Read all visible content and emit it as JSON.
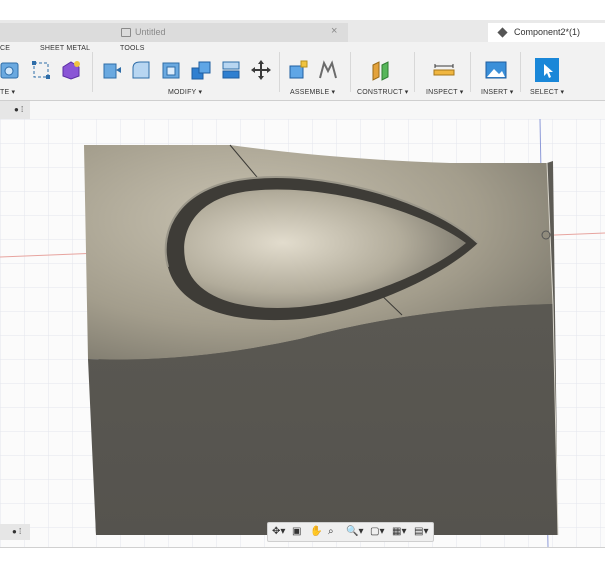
{
  "tabs": {
    "document_title": "Untitled",
    "component_title": "Component2*(1)",
    "close_glyph": "×"
  },
  "toolbar": {
    "menus": {
      "create_partial": "CE",
      "sheet_metal": "SHEET METAL",
      "tools": "TOOLS"
    },
    "groups": {
      "create_partial": "TE ▾",
      "modify": "MODIFY ▾",
      "assemble": "ASSEMBLE ▾",
      "construct": "CONSTRUCT ▾",
      "inspect": "INSPECT ▾",
      "insert": "INSERT ▾",
      "select": "SELECT ▾"
    },
    "icons": [
      "box-icon",
      "sketch-icon",
      "form-icon",
      "press-pull-icon",
      "fillet-icon",
      "shell-icon",
      "combine-icon",
      "replace-face-icon",
      "move-icon",
      "new-component-icon",
      "joint-icon",
      "offset-plane-icon",
      "measure-icon",
      "insert-image-icon",
      "select-icon"
    ]
  },
  "browser_strip": {
    "ctrl": "● ⁞"
  },
  "corner": {
    "ctrl": "● ⁞"
  },
  "navbar": {
    "items": [
      "✥▾",
      "▣",
      "✋",
      "⌕",
      "🔍▾",
      "▢▾",
      "▦▾",
      "▤▾"
    ]
  },
  "colors": {
    "canvas_bg": "#fbfbfb",
    "grid": "#e3e6ec",
    "x_axis": "#e7a49f",
    "y_axis": "#8d9ad8",
    "part_top_light": "#bdb6a3",
    "part_top_dark": "#6d6a60",
    "part_front": "#595751",
    "tab_active": "#ffffff",
    "tab_inactive": "#dcdcdc",
    "select_blue": "#1a87d8"
  }
}
